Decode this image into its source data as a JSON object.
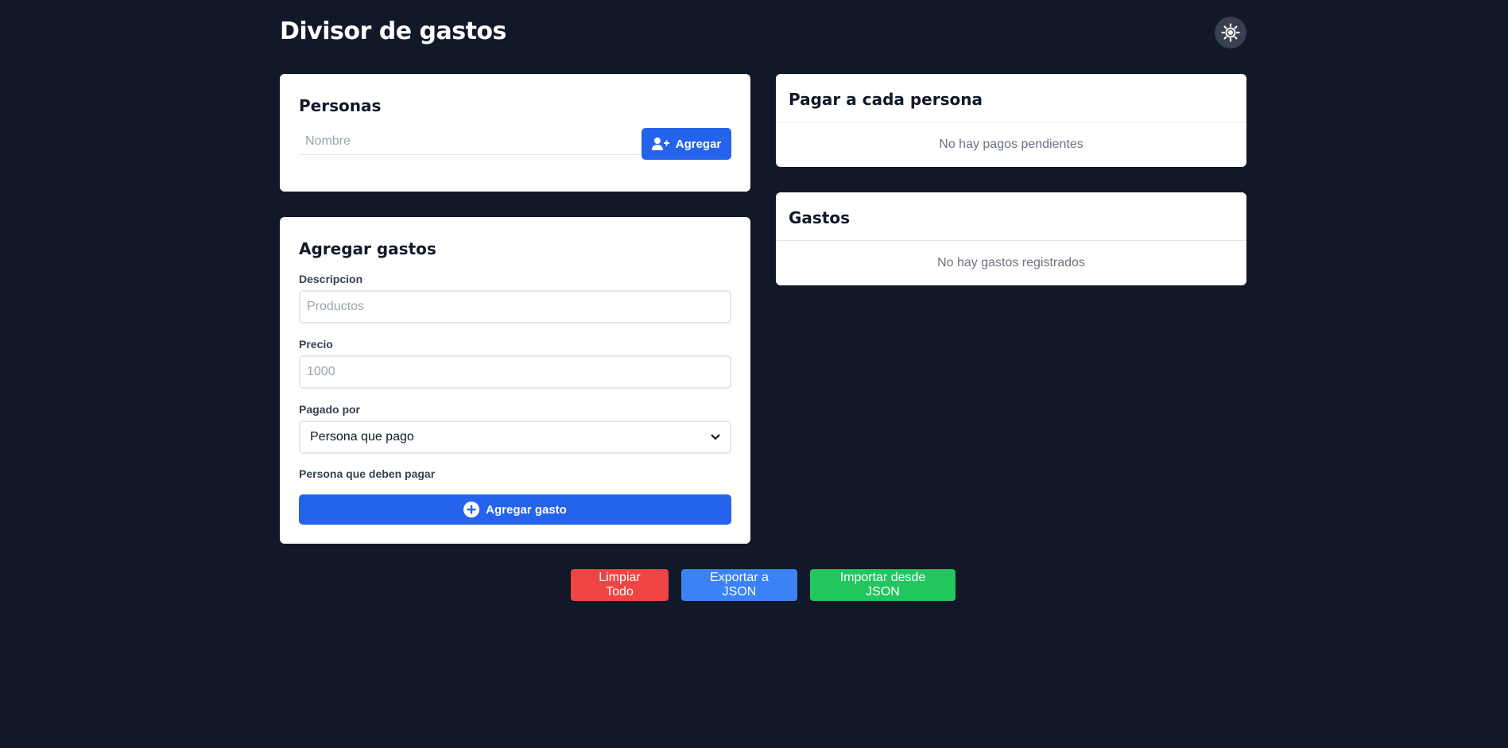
{
  "header": {
    "title": "Divisor de gastos",
    "theme_icon": "sun-icon"
  },
  "personas": {
    "title": "Personas",
    "name_placeholder": "Nombre",
    "add_label": "Agregar",
    "add_icon": "user-plus-icon"
  },
  "expense_form": {
    "title": "Agregar gastos",
    "description_label": "Descripcion",
    "description_placeholder": "Productos",
    "price_label": "Precio",
    "price_placeholder": "1000",
    "paid_by_label": "Pagado por",
    "paid_by_selected": "Persona que pago",
    "debtors_label": "Persona que deben pagar",
    "submit_label": "Agregar gasto",
    "submit_icon": "plus-circle-icon"
  },
  "payments": {
    "title": "Pagar a cada persona",
    "empty": "No hay pagos pendientes"
  },
  "expenses": {
    "title": "Gastos",
    "empty": "No hay gastos registrados"
  },
  "actions": {
    "clear": "Limpiar Todo",
    "export": "Exportar a JSON",
    "import": "Importar desde JSON"
  },
  "colors": {
    "background": "#111827",
    "primary": "#2563eb",
    "danger": "#ef4444",
    "info": "#3b82f6",
    "success": "#22c55e"
  }
}
